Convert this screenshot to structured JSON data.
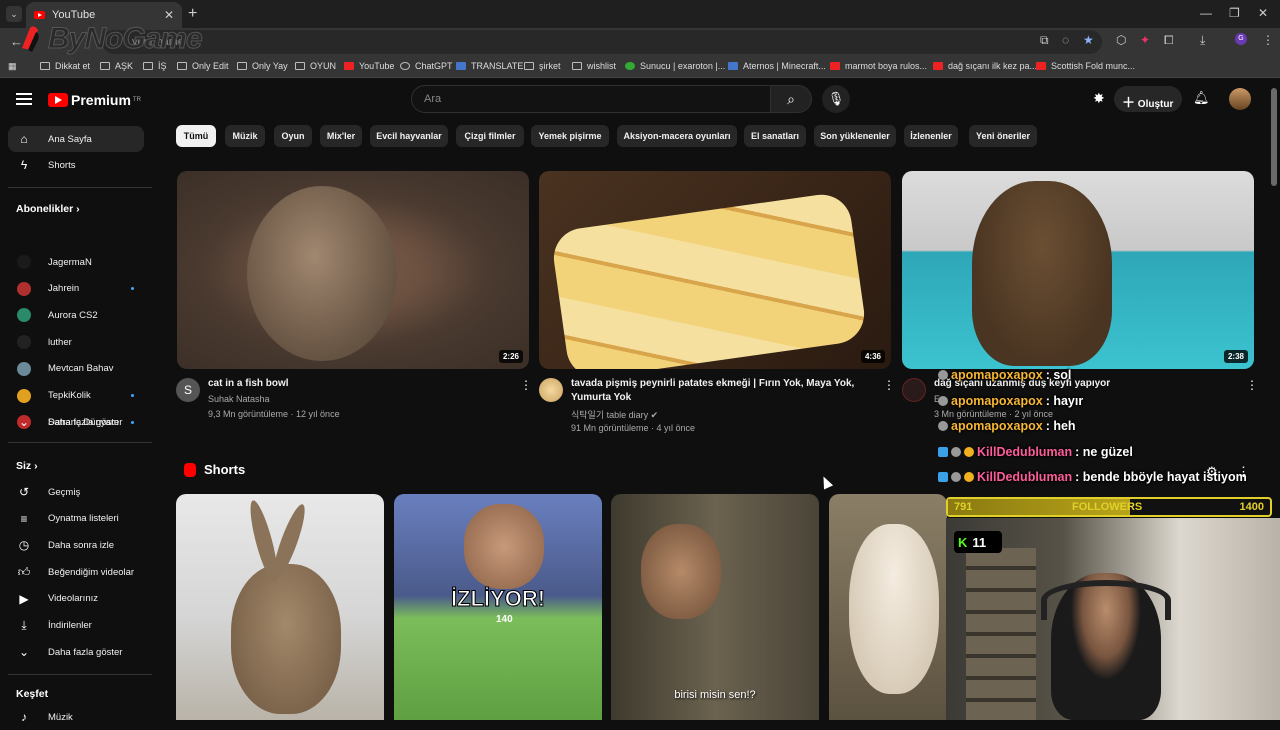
{
  "browser": {
    "tab_title": "YouTube",
    "url_fragment": "your name",
    "bookmarks": [
      {
        "label": "Dikkat et",
        "icon": "folder"
      },
      {
        "label": "AŞK",
        "icon": "folder"
      },
      {
        "label": "İŞ",
        "icon": "folder"
      },
      {
        "label": "Only Edit",
        "icon": "folder"
      },
      {
        "label": "Only Yay",
        "icon": "folder"
      },
      {
        "label": "OYUN",
        "icon": "folder"
      },
      {
        "label": "YouTube",
        "icon": "youtube"
      },
      {
        "label": "ChatGPT",
        "icon": "chatgpt"
      },
      {
        "label": "TRANSLATE",
        "icon": "translate"
      },
      {
        "label": "şirket",
        "icon": "folder"
      },
      {
        "label": "wishlist",
        "icon": "folder"
      },
      {
        "label": "Sunucu | exaroton |...",
        "icon": "exaroton"
      },
      {
        "label": "Aternos | Minecraft...",
        "icon": "aternos"
      },
      {
        "label": "marmot boya rulos...",
        "icon": "youtube"
      },
      {
        "label": "dağ sıçanı ilk kez pa...",
        "icon": "youtube"
      },
      {
        "label": "Scottish Fold munc...",
        "icon": "youtube"
      }
    ],
    "watermark": "ByNoGame"
  },
  "header": {
    "logo_text": "Premium",
    "logo_region": "TR",
    "search_placeholder": "Ara",
    "create_label": "Oluştur"
  },
  "sidebar": {
    "main": [
      {
        "label": "Ana Sayfa",
        "icon": "home-icon",
        "active": true
      },
      {
        "label": "Shorts",
        "icon": "shorts-icon"
      }
    ],
    "subs_heading": "Abonelikler",
    "subs": [
      {
        "label": "JagermaN",
        "color": "#1a1a1a",
        "dot": false
      },
      {
        "label": "Jahrein",
        "color": "#b03030",
        "dot": true
      },
      {
        "label": "Aurora CS2",
        "color": "#2a8a6a",
        "dot": false
      },
      {
        "label": "luther",
        "color": "#222222",
        "dot": false
      },
      {
        "label": "Mevtcan Bahav",
        "color": "#6a8a9a",
        "dot": false
      },
      {
        "label": "TepkiKolik",
        "color": "#e0a020",
        "dot": true
      },
      {
        "label": "Satranç Dünyam",
        "color": "#c02a2a",
        "dot": true
      }
    ],
    "subs_more": "Daha fazla göster",
    "you_heading": "Siz",
    "you": [
      {
        "label": "Geçmiş",
        "icon": "history-icon"
      },
      {
        "label": "Oynatma listeleri",
        "icon": "playlists-icon"
      },
      {
        "label": "Daha sonra izle",
        "icon": "clock-icon"
      },
      {
        "label": "Beğendiğim videolar",
        "icon": "like-icon"
      },
      {
        "label": "Videolarınız",
        "icon": "your-videos-icon"
      },
      {
        "label": "İndirilenler",
        "icon": "download-icon"
      },
      {
        "label": "Daha fazla göster",
        "icon": "chevron-down-icon"
      }
    ],
    "explore_heading": "Keşfet",
    "explore": [
      {
        "label": "Müzik",
        "icon": "music-icon"
      }
    ]
  },
  "chips": [
    "Tümü",
    "Müzik",
    "Oyun",
    "Mix'ler",
    "Evcil hayvanlar",
    "Çizgi filmler",
    "Yemek pişirme",
    "Aksiyon-macera oyunları",
    "El sanatları",
    "Son yüklenenler",
    "İzlenenler",
    "Yeni öneriler"
  ],
  "videos": [
    {
      "title_lines": [
        "cat in a fish bowl"
      ],
      "channel": "Suhak Natasha",
      "meta": "9,3 Mn görüntüleme · 12 yıl önce",
      "duration": "2:26",
      "avatar_letter": "S"
    },
    {
      "title_lines": [
        "tavada pişmiş peynirli patates ekmeği | Fırın Yok, Maya Yok,",
        "Yumurta Yok"
      ],
      "channel": "식탁일기 table diary",
      "meta": "91 Mn görüntüleme · 4 yıl önce",
      "duration": "4:36",
      "avatar_letter": ""
    },
    {
      "title_lines": [
        "dağ sıçanı uzanmış duş keyfi yapıyor"
      ],
      "channel": "E...",
      "meta": "3 Mn görüntüleme · 2 yıl önce",
      "duration": "2:38",
      "avatar_letter": ""
    }
  ],
  "shorts_heading": "Shorts",
  "shorts": [
    {
      "caption": ""
    },
    {
      "caption": "İZLİYOR!",
      "counter": "140"
    },
    {
      "caption": "birisi misin sen!?"
    },
    {
      "caption": ""
    }
  ],
  "overlay": {
    "chat": [
      {
        "user": "apomapoxapox",
        "msg": ": sol",
        "style": "u1"
      },
      {
        "user": "apomapoxapox",
        "msg": ": hayır",
        "style": "u1"
      },
      {
        "user": "apomapoxapox",
        "msg": ": heh",
        "style": "u1"
      },
      {
        "user": "KillDedubluman",
        "msg": ": ne güzel",
        "style": "u2"
      },
      {
        "user": "KillDedubluman",
        "msg": ": bende bböyle hayat istiyom",
        "style": "u2"
      }
    ],
    "followers_current": "791",
    "followers_label": "FOLLOWERS",
    "followers_goal": "1400",
    "followers_progress": 0.565,
    "kick_count": "11"
  }
}
